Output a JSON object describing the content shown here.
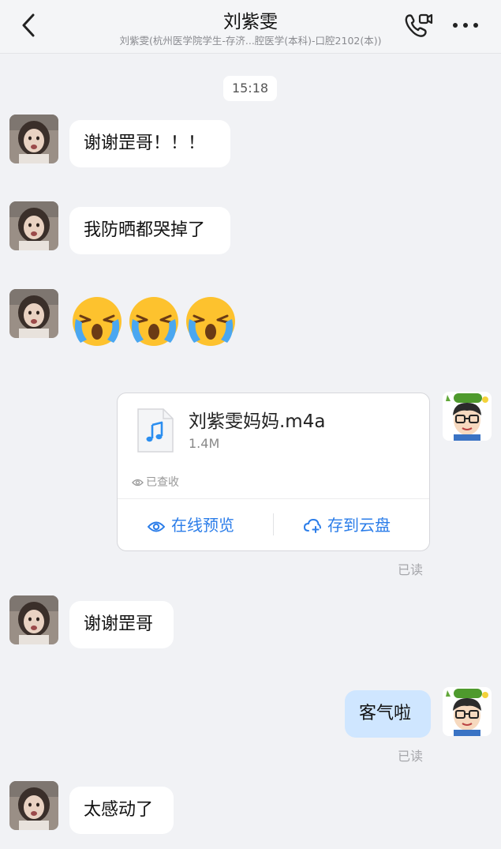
{
  "header": {
    "title": "刘紫雯",
    "subtitle": "刘紫雯(杭州医学院学生-存济...腔医学(本科)-口腔2102(本))"
  },
  "timestamp": "15:18",
  "messages": {
    "m1": "谢谢罡哥！！！",
    "m2": "我防晒都哭掉了",
    "m3_emojis": [
      "crying-face",
      "crying-face",
      "crying-face"
    ],
    "file": {
      "name": "刘紫雯妈妈.m4a",
      "size": "1.4M",
      "status": "已查收",
      "preview_label": "在线预览",
      "save_label": "存到云盘",
      "read_label": "已读"
    },
    "m5": "谢谢罡哥",
    "m6": "客气啦",
    "m6_read": "已读",
    "m7": "太感动了"
  },
  "colors": {
    "accent": "#2b7de9",
    "my_bubble": "#cfe6ff",
    "background": "#f1f2f5"
  }
}
